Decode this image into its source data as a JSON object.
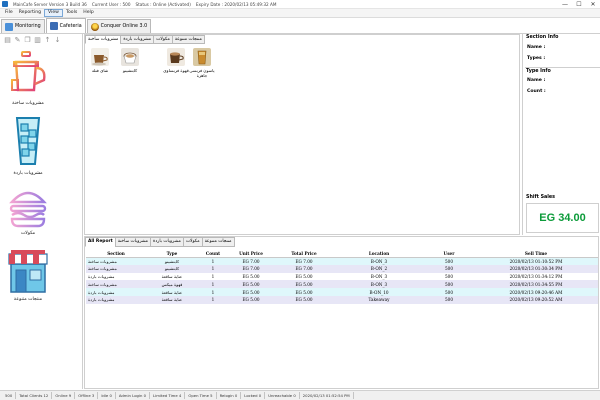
{
  "titlebar": {
    "segments": [
      "MainCafe Server Version 3 Build 36",
      "Current User : 500",
      "Status : Online (Activated)",
      "Expiry Date : 2020/02/13 05:49:32 AM"
    ],
    "minimize": "—",
    "maximize": "☐",
    "close": "✕"
  },
  "menu": [
    "File",
    "Reporting",
    "View",
    "Tools",
    "Help"
  ],
  "top_tabs": [
    "Monitoring",
    "Cafeteria",
    "Conquer Online 3.0"
  ],
  "categories": [
    "مشروبات ساخنة",
    "مشروبات باردة",
    "مكولات",
    "منتجات متنوعة"
  ],
  "product_tabs": [
    "مشروبات ساخنة",
    "مشروبات باردة",
    "مكولات",
    "منتجات متنوعة"
  ],
  "products": [
    "شاى فتله",
    "كابتشينو",
    "قهوة فرنساوى",
    "ياسون فرنسى جاهزة"
  ],
  "info": {
    "section_title": "Section Info",
    "name_label": "Name :",
    "types_label": "Types :",
    "type_title": "Type Info",
    "type_name_label": "Name :",
    "count_label": "Count :",
    "shift_title": "Shift Sales",
    "shift_value": "EG 34.00"
  },
  "report_tabs": [
    "All Report",
    "مشروبات ساخنة",
    "مشروبات باردة",
    "مكولات",
    "منتجات متنوعة"
  ],
  "report_columns": [
    "Section",
    "Type",
    "Count",
    "Unit Price",
    "Total Price",
    "Location",
    "User",
    "Sell Time"
  ],
  "report_rows": [
    [
      "مشروبات ساخنة",
      "كابتشينو",
      "1",
      "EG 7.00",
      "EG 7.00",
      "B-ON_3",
      "500",
      "2020/02/13 01:10:52 PM"
    ],
    [
      "مشروبات ساخنة",
      "كابتشينو",
      "1",
      "EG 7.00",
      "EG 7.00",
      "B-ON_2",
      "500",
      "2020/02/13 01:30:34 PM"
    ],
    [
      "مشروبات باردة",
      "عناية ساقعة",
      "1",
      "EG 5.00",
      "EG 5.00",
      "B-ON_3",
      "500",
      "2020/02/13 01:34:12 PM"
    ],
    [
      "مشروبات ساخنة",
      "قهوة ميكس",
      "1",
      "EG 5.00",
      "EG 5.00",
      "B-ON_3",
      "500",
      "2020/02/13 01:34:55 PM"
    ],
    [
      "مشروبات باردة",
      "عناية ساقعة",
      "1",
      "EG 5.00",
      "EG 5.00",
      "B-ON_10",
      "500",
      "2020/02/13 09:20:46 AM"
    ],
    [
      "مشروبات باردة",
      "عناية ساقعة",
      "1",
      "EG 5.00",
      "EG 5.00",
      "Takeaway",
      "500",
      "2020/02/13 09:20:52 AM"
    ]
  ],
  "row_colors": [
    "#dff7fb",
    "#e7e6f6",
    "#ffffff"
  ],
  "status_bar": [
    "500",
    "Total Clients 12",
    "Online 9",
    "Offline 3",
    "Idle 0",
    "Admin Login 0",
    "Limited Time 4",
    "Open Time 5",
    "Relogin 0",
    "Locked 0",
    "Unreachable 0",
    "2020/02/13 01:52:54 PM"
  ],
  "colors": {
    "shift_sales": "#0c9b3a",
    "accent": "#1f6fbf"
  }
}
